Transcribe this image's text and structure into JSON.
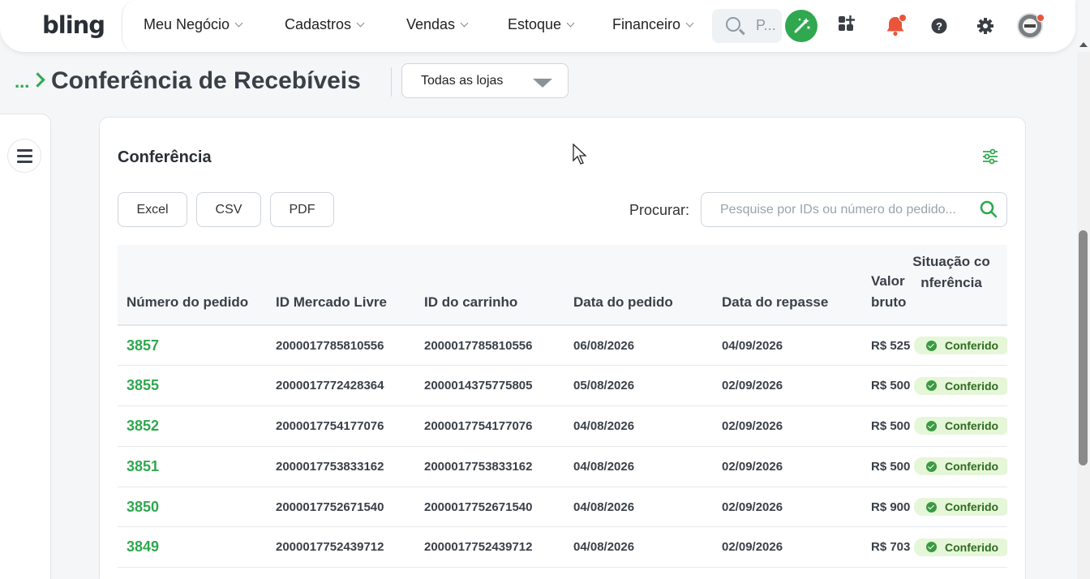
{
  "nav": {
    "logo": "bling",
    "items": [
      {
        "label": "Meu Negócio"
      },
      {
        "label": "Cadastros"
      },
      {
        "label": "Vendas"
      },
      {
        "label": "Estoque"
      },
      {
        "label": "Financeiro"
      }
    ],
    "search_placeholder": "P...",
    "icons": [
      "magic-wand-icon",
      "apps-icon",
      "bell-icon",
      "help-icon",
      "gear-icon",
      "avatar"
    ]
  },
  "header": {
    "breadcrumb_dots": "...",
    "title": "Conferência de Recebíveis",
    "store_select": "Todas as lojas"
  },
  "card": {
    "title": "Conferência",
    "export_buttons": [
      "Excel",
      "CSV",
      "PDF"
    ],
    "search_label": "Procurar:",
    "search_placeholder": "Pesquise por IDs ou número do pedido..."
  },
  "table": {
    "columns": [
      "Número do pedido",
      "ID Mercado Livre",
      "ID do carrinho",
      "Data do pedido",
      "Data do repasse",
      "Valor bruto",
      "Situação conferência"
    ],
    "rows": [
      {
        "numero": "3857",
        "id_ml": "2000017785810556",
        "id_carrinho": "2000017785810556",
        "data_pedido": "06/08/2026",
        "data_repasse": "04/09/2026",
        "valor": "R$ 525",
        "situacao": "Conferido"
      },
      {
        "numero": "3855",
        "id_ml": "2000017772428364",
        "id_carrinho": "2000014375775805",
        "data_pedido": "05/08/2026",
        "data_repasse": "02/09/2026",
        "valor": "R$ 500",
        "situacao": "Conferido"
      },
      {
        "numero": "3852",
        "id_ml": "2000017754177076",
        "id_carrinho": "2000017754177076",
        "data_pedido": "04/08/2026",
        "data_repasse": "02/09/2026",
        "valor": "R$ 500",
        "situacao": "Conferido"
      },
      {
        "numero": "3851",
        "id_ml": "2000017753833162",
        "id_carrinho": "2000017753833162",
        "data_pedido": "04/08/2026",
        "data_repasse": "02/09/2026",
        "valor": "R$ 500",
        "situacao": "Conferido"
      },
      {
        "numero": "3850",
        "id_ml": "2000017752671540",
        "id_carrinho": "2000017752671540",
        "data_pedido": "04/08/2026",
        "data_repasse": "02/09/2026",
        "valor": "R$ 900",
        "situacao": "Conferido"
      },
      {
        "numero": "3849",
        "id_ml": "2000017752439712",
        "id_carrinho": "2000017752439712",
        "data_pedido": "04/08/2026",
        "data_repasse": "02/09/2026",
        "valor": "R$ 703",
        "situacao": "Conferido"
      }
    ]
  },
  "colors": {
    "accent": "#2fa84f",
    "badge_bg": "#e6f6d9",
    "badge_text": "#2d6b1f",
    "notification": "#e8553b"
  }
}
